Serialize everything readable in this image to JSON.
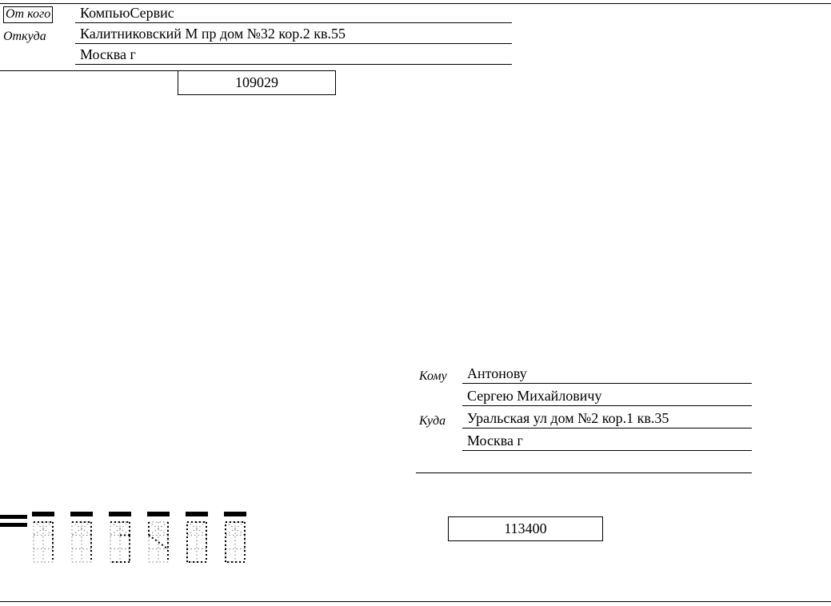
{
  "sender": {
    "from_label": "От кого",
    "from_value": "КомпьюСервис",
    "where_label": "Откуда",
    "address_line1": "Калитниковский М пр дом №32 кор.2 кв.55",
    "address_line2": "Москва г",
    "index": "109029"
  },
  "recipient": {
    "to_label": "Кому",
    "to_line1": "Антонову",
    "to_line2": "Сергею Михайловичу",
    "where_label": "Куда",
    "address_line1": "Уральская ул дом №2 кор.1 кв.35",
    "address_line2": "Москва г",
    "index": "113400"
  },
  "postal_digits": [
    "1",
    "1",
    "3",
    "4",
    "0",
    "0"
  ]
}
